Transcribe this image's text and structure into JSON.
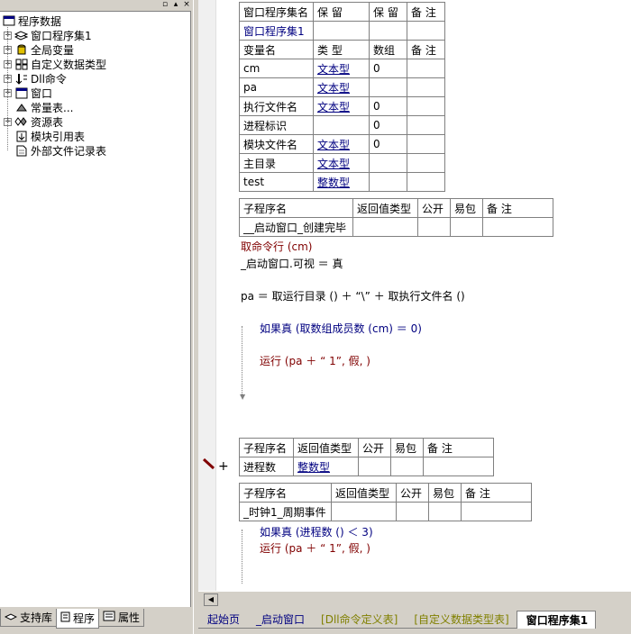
{
  "tree": {
    "root": "程序数据",
    "items": [
      {
        "label": "窗口程序集1",
        "expand": "+",
        "icon": "assembly-icon"
      },
      {
        "label": "全局变量",
        "expand": "+",
        "icon": "global-var-icon"
      },
      {
        "label": "自定义数据类型",
        "expand": "+",
        "icon": "datatype-icon"
      },
      {
        "label": "Dll命令",
        "expand": "+",
        "icon": "dll-icon"
      },
      {
        "label": "窗口",
        "expand": "+",
        "icon": "window-icon"
      },
      {
        "label": "常量表...",
        "expand": "",
        "icon": "constant-icon"
      },
      {
        "label": "资源表",
        "expand": "+",
        "icon": "resource-icon"
      },
      {
        "label": "模块引用表",
        "expand": "",
        "icon": "module-icon"
      },
      {
        "label": "外部文件记录表",
        "expand": "",
        "icon": "external-file-icon"
      }
    ]
  },
  "pane_buttons": [
    "▫",
    "▴",
    "×"
  ],
  "left_tabs": [
    "支持库",
    "程序",
    "属性"
  ],
  "assembly_table": {
    "header": [
      "窗口程序集名",
      "保 留",
      "保 留",
      "备 注"
    ],
    "name": "窗口程序集1",
    "var_header": [
      "变量名",
      "类 型",
      "数组",
      "备 注"
    ],
    "vars": [
      {
        "name": "cm",
        "type": "文本型",
        "arr": "0"
      },
      {
        "name": "pa",
        "type": "文本型",
        "arr": ""
      },
      {
        "name": "执行文件名",
        "type": "文本型",
        "arr": "0"
      },
      {
        "name": "进程标识",
        "type": "",
        "arr": "0"
      },
      {
        "name": "模块文件名",
        "type": "文本型",
        "arr": "0"
      },
      {
        "name": "主目录",
        "type": "文本型",
        "arr": ""
      },
      {
        "name": "test",
        "type": "整数型",
        "arr": ""
      }
    ]
  },
  "sub1": {
    "header": [
      "子程序名",
      "返回值类型",
      "公开",
      "易包",
      "备 注"
    ],
    "name": "__启动窗口_创建完毕",
    "code": [
      "取命令行 (cm)",
      "_启动窗口.可视 ＝ 真",
      "pa ＝ 取运行目录 () ＋ “\\” ＋ 取执行文件名 ()",
      "如果真 (取数组成员数 (cm) ＝ 0)",
      "运行 (pa ＋ “ 1”, 假, )"
    ]
  },
  "sub2": {
    "header": [
      "子程序名",
      "返回值类型",
      "公开",
      "易包",
      "备 注"
    ],
    "name": "进程数",
    "type": "整数型",
    "plus": "+"
  },
  "sub3": {
    "header": [
      "子程序名",
      "返回值类型",
      "公开",
      "易包",
      "备 注"
    ],
    "name": "_时钟1_周期事件",
    "code": [
      "如果真 (进程数 () ＜ 3)",
      "运行 (pa ＋ “ 1”, 假, )"
    ]
  },
  "editor_tabs": [
    "起始页",
    "_启动窗口",
    "[Dll命令定义表]",
    "[自定义数据类型表]",
    "窗口程序集1"
  ],
  "colors": {
    "keyword": "#000080",
    "command": "#800000",
    "background": "#d4d0c8"
  }
}
